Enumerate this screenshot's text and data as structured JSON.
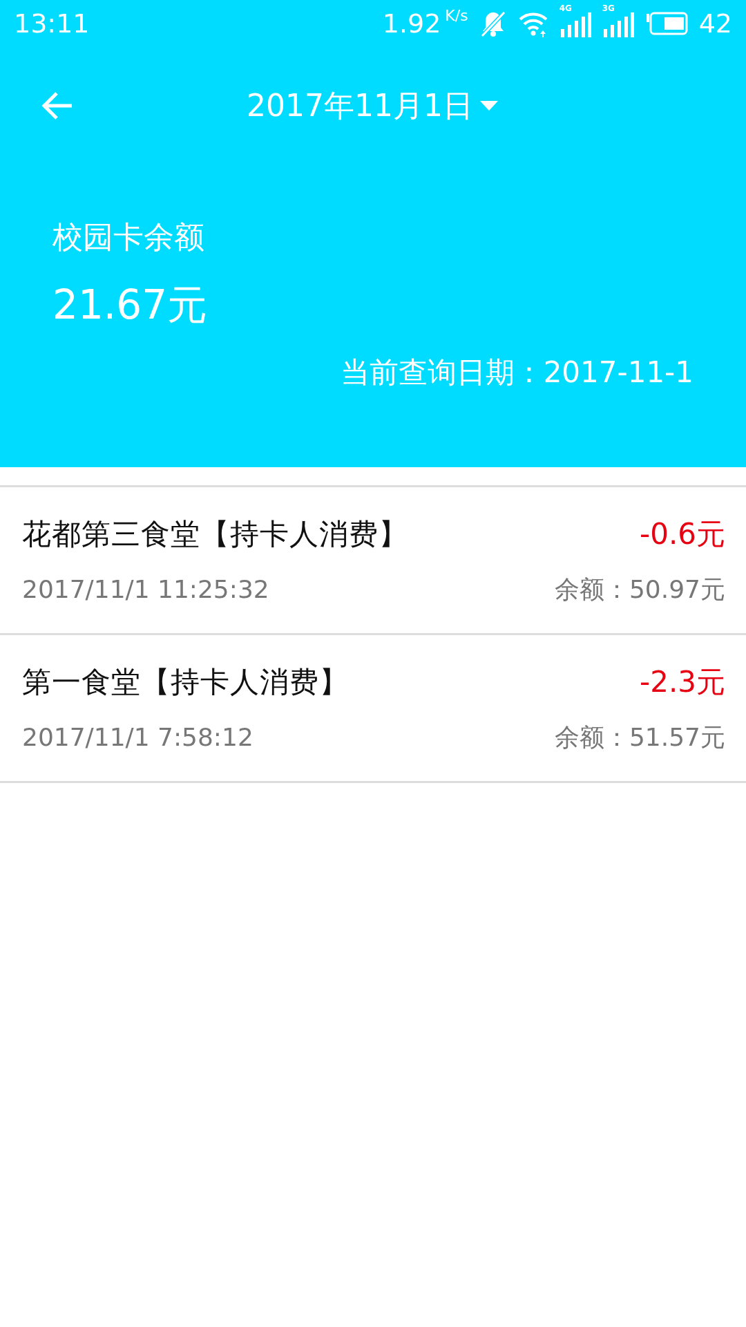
{
  "status_bar": {
    "time": "13:11",
    "speed": "1.92",
    "speed_unit": "K/s",
    "networks": [
      "4G",
      "3G"
    ],
    "battery": "42"
  },
  "header": {
    "title": "2017年11月1日"
  },
  "balance": {
    "label": "校园卡余额",
    "amount": "21.67元",
    "query_date": "当前查询日期：2017-11-1"
  },
  "transactions": [
    {
      "place": "花都第三食堂【持卡人消费】",
      "amount": "-0.6元",
      "time": "2017/11/1 11:25:32",
      "balance": "余额：50.97元"
    },
    {
      "place": "第一食堂【持卡人消费】",
      "amount": "-2.3元",
      "time": "2017/11/1 7:58:12",
      "balance": "余额：51.57元"
    }
  ]
}
